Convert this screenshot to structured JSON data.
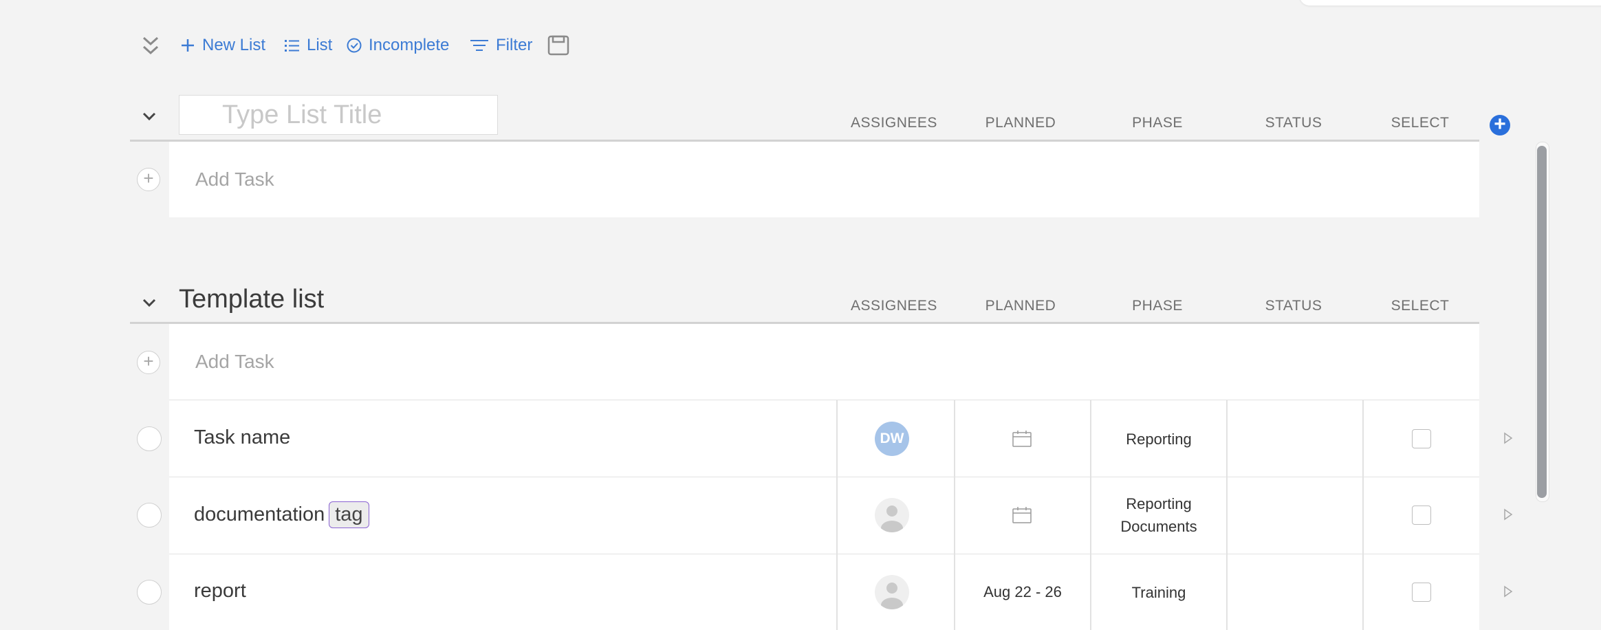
{
  "toolbar": {
    "new_list": "New List",
    "list": "List",
    "incomplete": "Incomplete",
    "filter": "Filter"
  },
  "new_list_section": {
    "title_placeholder": "Type List Title",
    "add_task": "Add Task"
  },
  "columns": [
    "ASSIGNEES",
    "PLANNED",
    "PHASE",
    "STATUS",
    "SELECT"
  ],
  "template_list": {
    "title": "Template list",
    "add_task": "Add Task",
    "tasks": [
      {
        "name": "Task name",
        "tag": "",
        "assignee_initials": "DW",
        "planned": "",
        "phase_line1": "Reporting",
        "phase_line2": "",
        "status": ""
      },
      {
        "name": "documentation",
        "tag": "tag",
        "assignee_initials": "",
        "planned": "",
        "phase_line1": "Reporting",
        "phase_line2": "Documents",
        "status": ""
      },
      {
        "name": "report",
        "tag": "",
        "assignee_initials": "",
        "planned": "Aug 22 - 26",
        "phase_line1": "Training",
        "phase_line2": "",
        "status": ""
      }
    ]
  },
  "colors": {
    "accent": "#3c7bd4",
    "add_button": "#2a6fdb",
    "tag_border": "#8a63d2",
    "avatar_bg": "#a6c4e9"
  }
}
